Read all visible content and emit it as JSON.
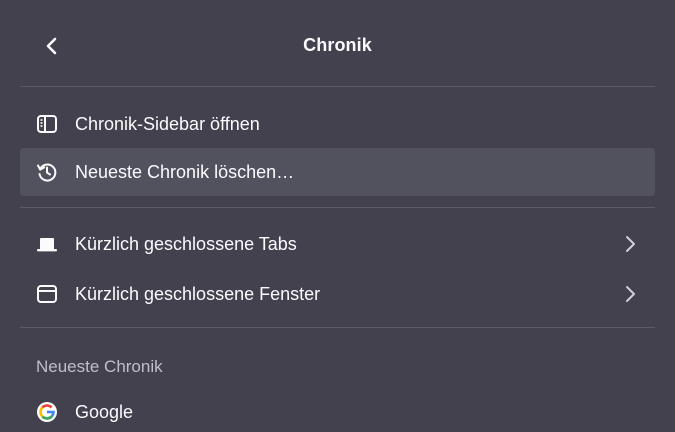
{
  "header": {
    "title": "Chronik",
    "back_icon": "back-chevron-icon"
  },
  "menu": {
    "items": [
      {
        "label": "Chronik-Sidebar öffnen",
        "icon": "sidebar-icon"
      },
      {
        "label": "Neueste Chronik löschen…",
        "icon": "history-clear-icon"
      },
      {
        "label": "Kürzlich geschlossene Tabs",
        "icon": "tab-icon",
        "submenu": true
      },
      {
        "label": "Kürzlich geschlossene Fenster",
        "icon": "window-icon",
        "submenu": true
      }
    ],
    "recent_section_label": "Neueste Chronik",
    "recent": [
      {
        "label": "Google",
        "icon": "google-favicon-icon"
      }
    ]
  },
  "colors": {
    "background": "#42414d",
    "hover": "#52525e",
    "text": "#fbfbfe",
    "muted_text": "#bfbfc9",
    "separator": "#5b5a66"
  }
}
